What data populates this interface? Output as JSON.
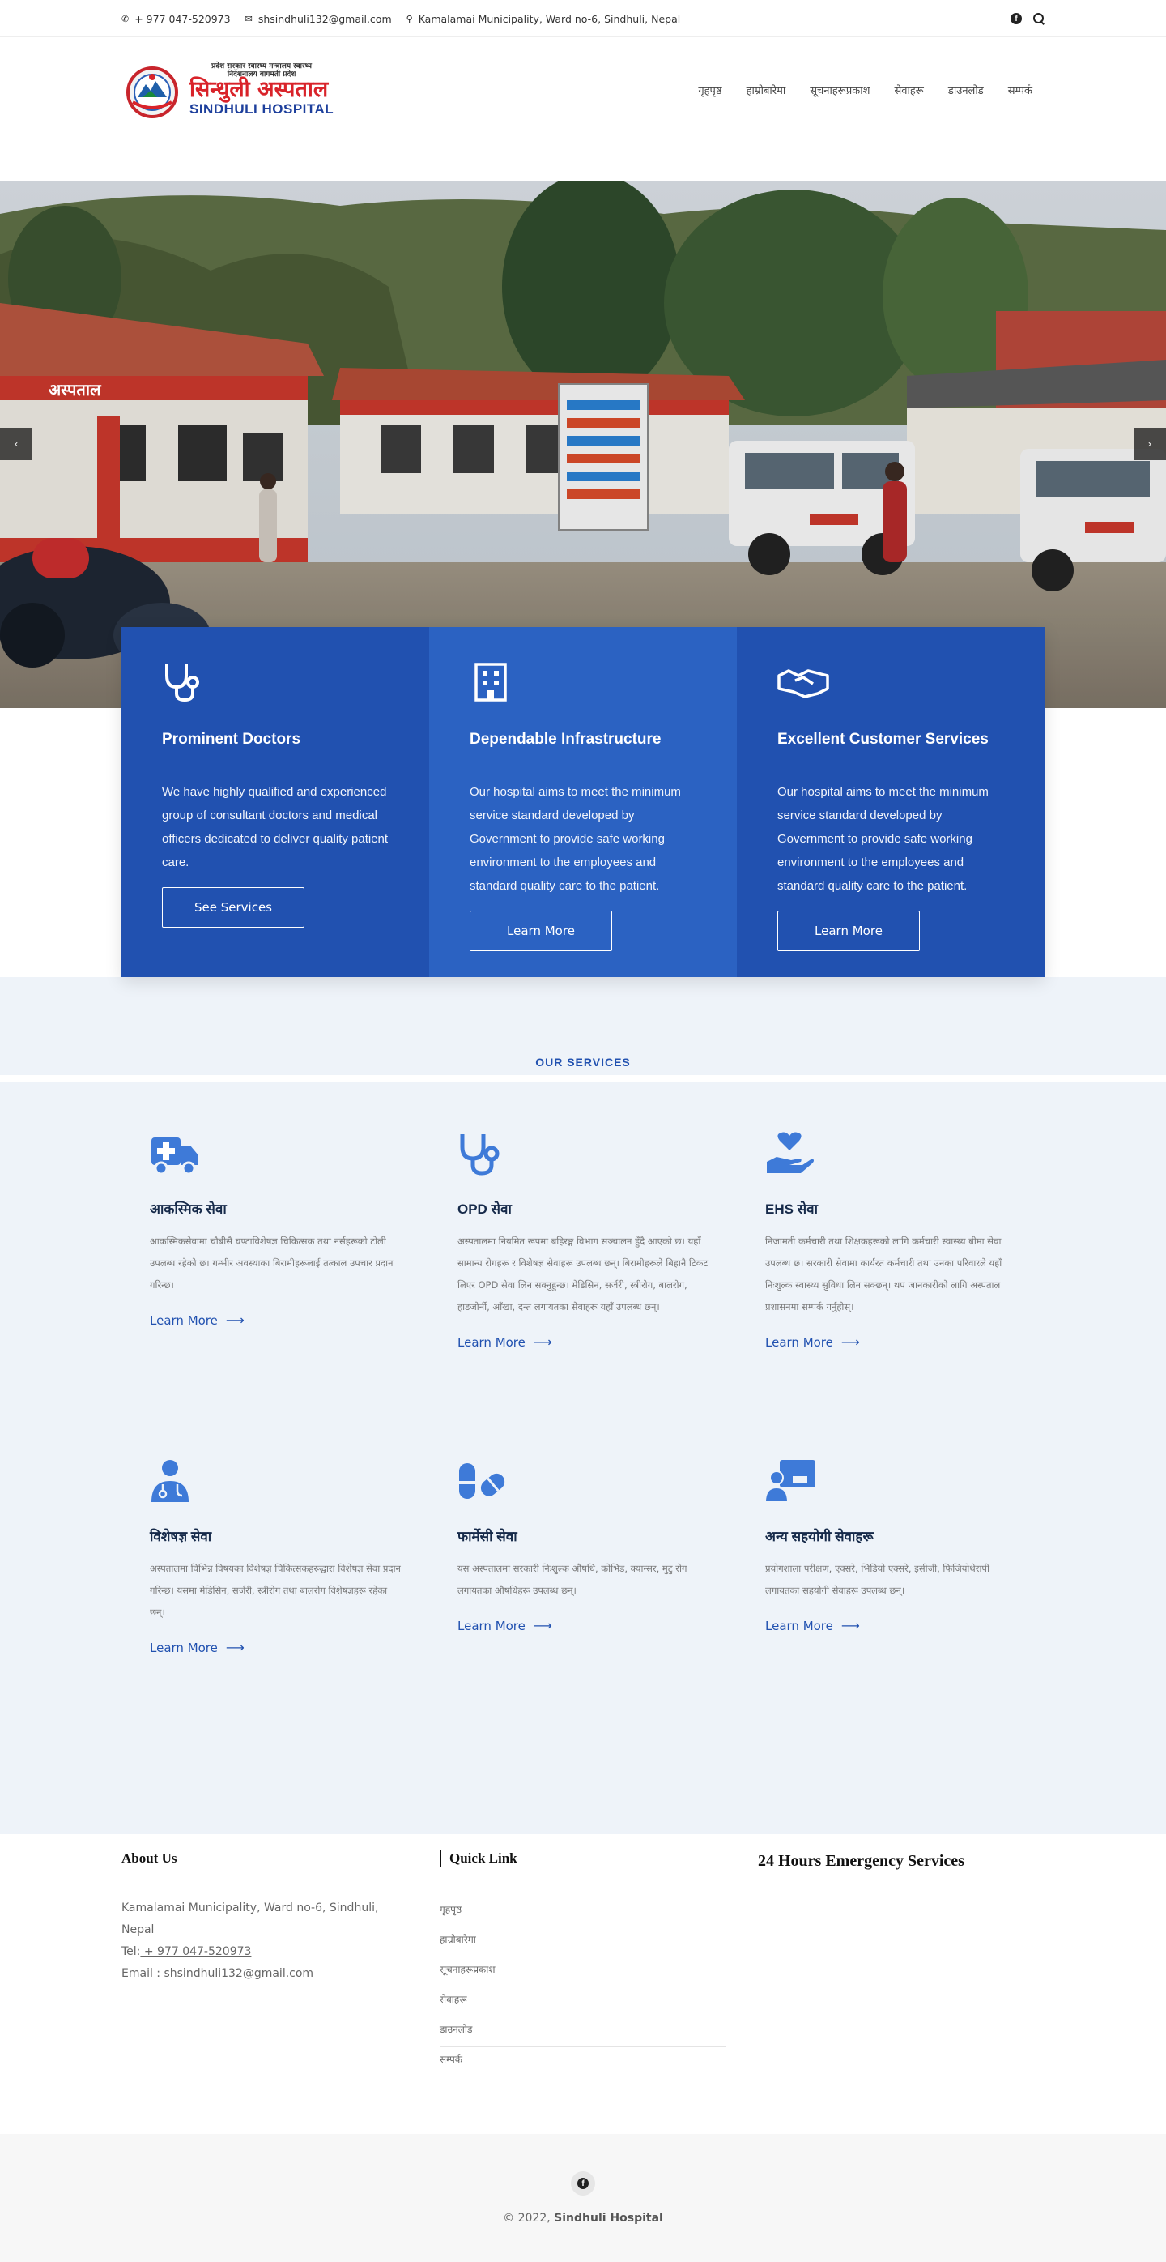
{
  "topbar": {
    "phone": "+ 977 047-520973",
    "email": "shsindhuli132@gmail.com",
    "address": "Kamalamai Municipality, Ward no-6, Sindhuli, Nepal",
    "icons": [
      "phone-icon",
      "envelope-icon",
      "map-marker-icon",
      "facebook-icon",
      "search-icon"
    ]
  },
  "logo": {
    "gov_line1": "प्रदेश सरकार स्वास्थ्य मन्त्रालय स्वास्थ्य",
    "gov_line2": "निर्देशनालय बागमती प्रदेश",
    "name_np": "सिन्धुली अस्पताल",
    "name_en": "SINDHULI HOSPITAL"
  },
  "nav": {
    "items": [
      "गृहपृष्ठ",
      "हाम्रोबारेमा",
      "सूचनाहरूप्रकाश",
      "सेवाहरू",
      "डाउनलोड",
      "सम्पर्क"
    ]
  },
  "hero": {
    "prev_label": "‹",
    "next_label": "›",
    "sign_text": "अस्पताल"
  },
  "features": [
    {
      "title": "Prominent Doctors",
      "text": "We have highly qualified and experienced group of consultant doctors and medical officers dedicated to deliver quality patient care.",
      "button": "See Services",
      "icon": "stethoscope-icon"
    },
    {
      "title": "Dependable Infrastructure",
      "text": "Our hospital aims to meet the minimum service standard developed by Government to provide safe working environment to the employees and standard quality care to the patient.",
      "button": "Learn More",
      "icon": "building-icon"
    },
    {
      "title": "Excellent Customer Services",
      "text": "Our hospital aims to meet the minimum service standard developed by Government to provide safe working environment to the employees and standard quality care to the patient.",
      "button": "Learn More",
      "icon": "handshake-icon"
    }
  ],
  "services": {
    "heading": "OUR SERVICES",
    "learn_more": "Learn More",
    "items": [
      {
        "icon": "ambulance-icon",
        "title": "आकस्मिक सेवा",
        "text": "आकस्मिकसेवामा चौबीसै घण्टाविशेषज्ञ चिकित्सक तथा नर्सहरूको टोली उपलब्ध रहेको छ। गम्भीर अवस्थाका बिरामीहरूलाई तत्काल उपचार प्रदान गरिन्छ।"
      },
      {
        "icon": "stethoscope-icon",
        "title": "OPD सेवा",
        "text": "अस्पतालमा नियमित रूपमा बहिरङ्ग विभाग सञ्चालन हुँदै आएको छ। यहाँ सामान्य रोगहरू र विशेषज्ञ सेवाहरू उपलब्ध छन्। बिरामीहरूले बिहानै टिकट लिएर OPD सेवा लिन सक्नुहुन्छ। मेडिसिन, सर्जरी, स्त्रीरोग, बालरोग, हाडजोर्नी, आँखा, दन्त लगायतका सेवाहरू यहाँ उपलब्ध छन्।"
      },
      {
        "icon": "hand-heart-icon",
        "title": "EHS सेवा",
        "text": "निजामती कर्मचारी तथा शिक्षकहरूको लागि कर्मचारी स्वास्थ्य बीमा सेवा उपलब्ध छ। सरकारी सेवामा कार्यरत कर्मचारी तथा उनका परिवारले यहाँ निःशुल्क स्वास्थ्य सुविधा लिन सक्छन्। थप जानकारीको लागि अस्पताल प्रशासनमा सम्पर्क गर्नुहोस्।"
      },
      {
        "icon": "user-doctor-icon",
        "title": "विशेषज्ञ सेवा",
        "text": "अस्पतालमा विभिन्न विषयका विशेषज्ञ चिकित्सकहरूद्वारा विशेषज्ञ सेवा प्रदान गरिन्छ। यसमा मेडिसिन, सर्जरी, स्त्रीरोग तथा बालरोग विशेषज्ञहरू रहेका छन्।"
      },
      {
        "icon": "pills-icon",
        "title": "फार्मेसी सेवा",
        "text": "यस अस्पतालमा सरकारी निःशुल्क औषधि, कोभिड, क्यान्सर, मुटु रोग लगायतका औषधिहरू उपलब्ध छन्।"
      },
      {
        "icon": "user-screen-icon",
        "title": "अन्य सहयोगी सेवाहरू",
        "text": "प्रयोगशाला परीक्षण, एक्सरे, भिडियो एक्सरे, इसीजी, फिजियोथेरापी लगायतका सहयोगी सेवाहरू उपलब्ध छन्।"
      }
    ]
  },
  "footer": {
    "about": {
      "title": "About Us",
      "address": "Kamalamai Municipality, Ward no-6, Sindhuli, Nepal",
      "tel_label": "Tel:",
      "tel": " + 977 047-520973",
      "email_label": "Email",
      "email": "shsindhuli132@gmail.com"
    },
    "quick": {
      "title": "Quick Link",
      "items": [
        "गृहपृष्ठ",
        "हाम्रोबारेमा",
        "सूचनाहरूप्रकाश",
        "सेवाहरू",
        "डाउनलोड",
        "सम्पर्क"
      ]
    },
    "emergency": {
      "title": "24 Hours Emergency Services"
    }
  },
  "bottom": {
    "copyright_prefix": "© 2022,",
    "copyright_name": "Sindhuli Hospital"
  },
  "colors": {
    "primary": "#2151b0",
    "primary_light": "#2b62c2",
    "service_icon": "#3e7ad8",
    "services_bg": "#eef3f9"
  }
}
